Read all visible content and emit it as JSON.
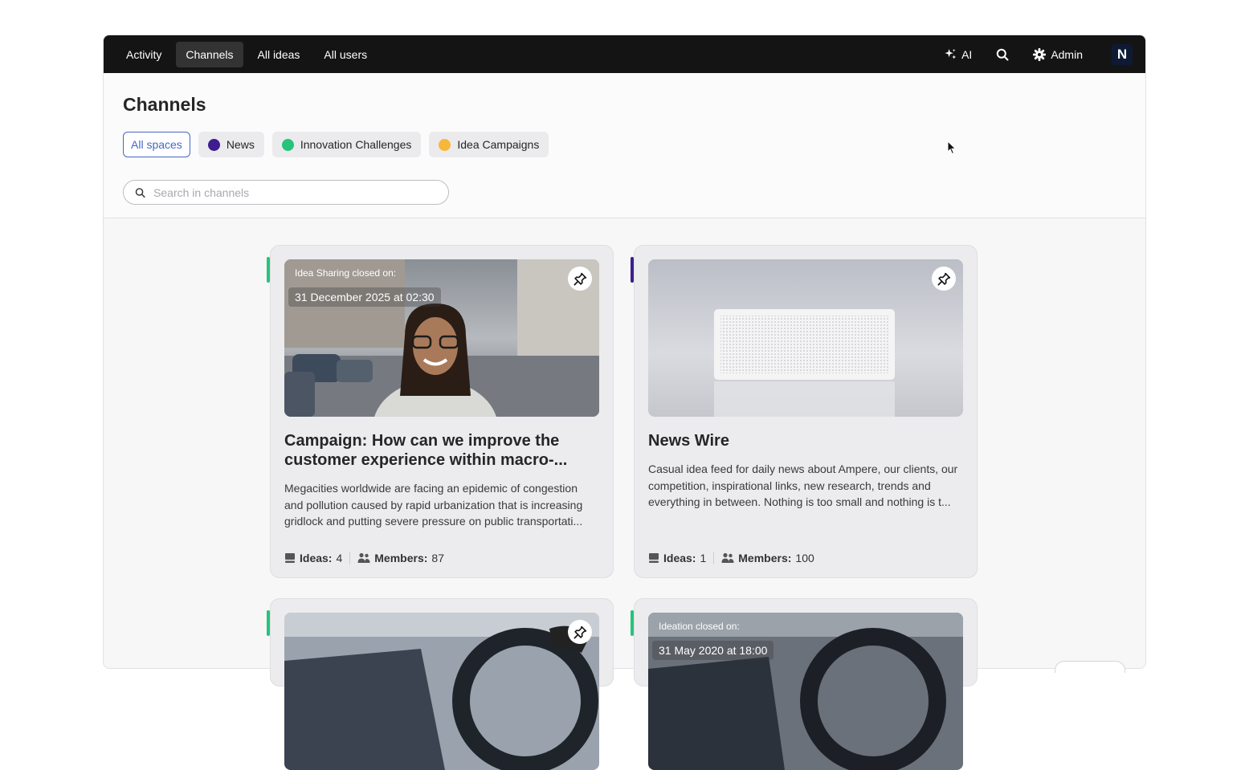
{
  "nav": {
    "items": [
      {
        "label": "Activity",
        "active": false
      },
      {
        "label": "Channels",
        "active": true
      },
      {
        "label": "All ideas",
        "active": false
      },
      {
        "label": "All users",
        "active": false
      }
    ],
    "ai_label": "AI",
    "admin_label": "Admin",
    "avatar_letter": "N"
  },
  "page": {
    "title": "Channels",
    "filters": [
      {
        "label": "All spaces",
        "color": null,
        "active": true
      },
      {
        "label": "News",
        "color": "#3d1d8f",
        "active": false
      },
      {
        "label": "Innovation Challenges",
        "color": "#25c47a",
        "active": false
      },
      {
        "label": "Idea Campaigns",
        "color": "#f7b73b",
        "active": false
      }
    ],
    "search_placeholder": "Search in channels"
  },
  "cards": [
    {
      "title": "Campaign: How can we improve the customer experience within macro-...",
      "description": "Megacities worldwide are facing an epidemic of congestion and pollution caused by rapid urbanization that is increasing gridlock and putting severe pressure on public transportati...",
      "closed_label": "Idea Sharing closed on:",
      "closed_date": "31 December 2025 at 02:30",
      "ideas_label": "Ideas:",
      "ideas_count": "4",
      "members_label": "Members:",
      "members_count": "87",
      "accent": "#25c47a"
    },
    {
      "title": "News Wire",
      "description": "Casual idea feed for daily news about Ampere, our clients, our competition, inspirational links, new research, trends and everything in between. Nothing is too small and nothing is t...",
      "ideas_label": "Ideas:",
      "ideas_count": "1",
      "members_label": "Members:",
      "members_count": "100",
      "accent": "#3d1d8f"
    },
    {
      "accent": "#25c47a"
    },
    {
      "closed_label": "Ideation closed on:",
      "closed_date": "31 May 2020 at 18:00",
      "accent": "#25c47a"
    }
  ]
}
